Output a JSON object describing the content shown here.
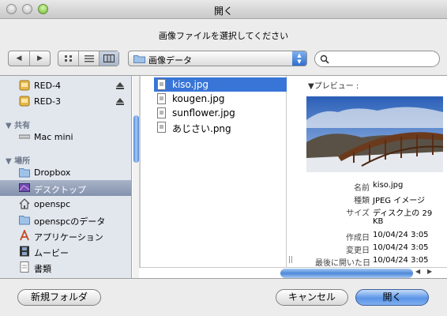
{
  "window": {
    "title": "開く",
    "prompt": "画像ファイルを選択してください"
  },
  "toolbar": {
    "location_popup": "画像データ",
    "search": {
      "value": "",
      "placeholder": ""
    }
  },
  "sidebar": {
    "devices": [
      {
        "label": "RED-4",
        "icon": "disk-icon",
        "ejectable": true
      },
      {
        "label": "RED-3",
        "icon": "disk-icon",
        "ejectable": true
      }
    ],
    "shared_header": "共有",
    "shared": [
      {
        "label": "Mac mini",
        "icon": "computer-icon"
      }
    ],
    "places_header": "場所",
    "places": [
      {
        "label": "Dropbox",
        "icon": "folder-icon"
      },
      {
        "label": "デスクトップ",
        "icon": "desktop-icon",
        "selected": true
      },
      {
        "label": "openspc",
        "icon": "home-icon"
      },
      {
        "label": "openspcのデータ",
        "icon": "folder-icon"
      },
      {
        "label": "アプリケーション",
        "icon": "applications-icon"
      },
      {
        "label": "ムービー",
        "icon": "movies-icon"
      },
      {
        "label": "書類",
        "icon": "documents-icon"
      }
    ]
  },
  "files": [
    {
      "name": "kiso.jpg",
      "selected": true
    },
    {
      "name": "kougen.jpg"
    },
    {
      "name": "sunflower.jpg"
    },
    {
      "name": "あじさい.png"
    }
  ],
  "preview": {
    "label": "プレビュー :",
    "info": [
      {
        "key": "名前",
        "value": "kiso.jpg"
      },
      {
        "key": "種類",
        "value": "JPEG イメージ"
      },
      {
        "key": "サイズ",
        "value": "ディスク上の 29"
      },
      {
        "key": "",
        "value": "KB"
      },
      {
        "key": "作成日",
        "value": "10/04/24 3:05"
      },
      {
        "key": "変更日",
        "value": "10/04/24 3:05"
      },
      {
        "key": "最後に開いた日",
        "value": "10/04/24 3:05"
      }
    ]
  },
  "buttons": {
    "new_folder": "新規フォルダ",
    "cancel": "キャンセル",
    "open": "開く"
  },
  "colors": {
    "selection": "#3875d7",
    "sidebar_bg": "#e2e7ee",
    "default_button": "#5a95e6"
  }
}
